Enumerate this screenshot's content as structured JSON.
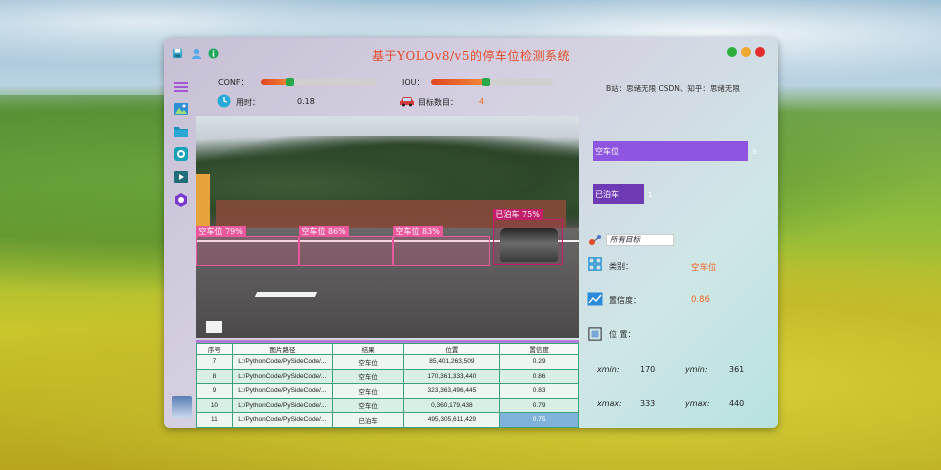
{
  "window": {
    "title": "基于YOLOv8/v5的停车位检测系统"
  },
  "controls": {
    "conf_label": "CONF：",
    "conf_value": 0.25,
    "iou_label": "IOU：",
    "iou_value": 0.45,
    "time_label": "用时：",
    "time_value": "0.18",
    "count_label": "目标数目：",
    "count_value": "4"
  },
  "preview": {
    "detections": [
      {
        "label": "空车位 79%"
      },
      {
        "label": "空车位 86%"
      },
      {
        "label": "空车位 83%"
      },
      {
        "label": "已泊车 75%"
      }
    ]
  },
  "results_table": {
    "headers": [
      "序号",
      "图片路径",
      "结果",
      "位置",
      "置信度"
    ],
    "rows": [
      [
        "7",
        "L:/PythonCode/PySideCode/...",
        "空车位",
        "85,401,263,509",
        "0.29"
      ],
      [
        "8",
        "L:/PythonCode/PySideCode/...",
        "空车位",
        "170,361,333,440",
        "0.86"
      ],
      [
        "9",
        "L:/PythonCode/PySideCode/...",
        "空车位",
        "323,363,496,445",
        "0.83"
      ],
      [
        "10",
        "L:/PythonCode/PySideCode/...",
        "空车位",
        "0,360,179,438",
        "0.79"
      ],
      [
        "11",
        "L:/PythonCode/PySideCode/...",
        "已泊车",
        "495,305,611,429",
        "0.75"
      ]
    ]
  },
  "right_panel": {
    "author": "B站：思绪无限  CSDN、知乎：思绪无限",
    "bars": [
      {
        "label": "空车位",
        "count": "3",
        "fraction": 1.0,
        "color": "#8d55e0"
      },
      {
        "label": "已泊车",
        "count": "1",
        "fraction": 0.33,
        "color": "#6e3bb5"
      }
    ],
    "target_select": "所有目标",
    "class_label": "类别：",
    "class_value": "空车位",
    "conf_label": "置信度：",
    "conf_value": "0.86",
    "position_label": "位 置：",
    "xmin_label": "xmin:",
    "xmin": "170",
    "ymin_label": "ymin:",
    "ymin": "361",
    "xmax_label": "xmax:",
    "xmax": "333",
    "ymax_label": "ymax:",
    "ymax": "440"
  },
  "icons": {
    "titlebar": [
      "save-icon",
      "user-icon",
      "info-icon"
    ],
    "sidebar": [
      "menu-icon",
      "image-icon",
      "folder-icon",
      "camera-icon",
      "video-icon",
      "model-icon"
    ]
  },
  "colors": {
    "title": "#e24b27",
    "accent_orange": "#f1651f",
    "slider_handle": "#29a84a",
    "close": "#e52b2b",
    "minimize": "#f0a830",
    "maximize": "#2fae3c"
  }
}
